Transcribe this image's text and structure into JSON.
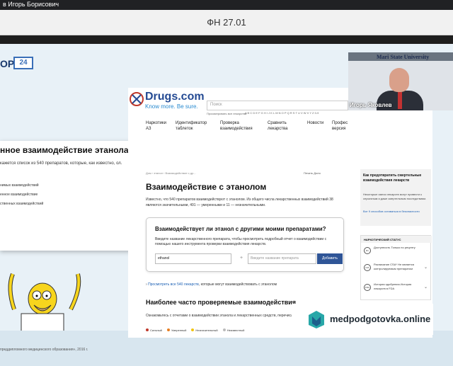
{
  "topbar": {
    "participant": "в Игорь Борисович"
  },
  "window": {
    "title": "ФН 27.01"
  },
  "slide": {
    "brand_text": "OP",
    "brand_badge": "24",
    "card_title": "нное взаимодействие этанола",
    "card_text": "кажется список из 540 препаратов, которые, как известно, ол.",
    "card_items": [
      "нимых взаимодействий",
      "енное взаимодействие",
      "ственных взаимодействий"
    ],
    "footer_note": "преддипломного медицинского образования», 2016 г."
  },
  "drugs": {
    "logo_name": "Drugs.com",
    "logo_slogan": "Know more. Be sure.",
    "search_placeholder": "Поиск",
    "search_sub": "Просматривать все лекарства",
    "alphabet": "A B C D E F G H I J K L M N O P Q R S T U V W X Y Z 0-9",
    "nav": [
      "Наркотики АЗ",
      "Идентификатор таблеток",
      "Проверка взаимодействия",
      "Сравнить лекарства",
      "Новости",
      "Профес версия"
    ],
    "breadcrumb": "Дом › этанол › Взаимодействие с др...",
    "actions": "Печать   Доля",
    "h1": "Взаимодействие с этанолом",
    "intro": "Известно, что 540 препаратов взаимодействуют с этанолом. Из общего числа лекарственных взаимодействий 38 являются значительными, 491 — умеренными и 11 — незначительными.",
    "box_title": "Взаимодействует ли этанол с другими моими препаратами?",
    "box_desc": "Введите название лекарственного препарата, чтобы просмотреть подробный отчет о взаимодействии с помощью нашего инструмента проверки взаимодействия лекарств.",
    "input1_value": "ethanol",
    "input2_placeholder": "Введите название препарата",
    "add_button": "Добавить",
    "link540": "Просмотреть все 540 лекарств",
    "link540_tail": ", которые могут взаимодействовать с этанолом",
    "h2": "Наиболее часто проверяемые взаимодействия",
    "desc2": "Ознакомьтесь с отчетами о взаимодействии этанола и лекарственных средств, перечисленных ниже.",
    "legend": [
      "Сильный",
      "Умеренный",
      "Незначительный",
      "Неизвестный"
    ],
    "legend_colors": [
      "#c0392b",
      "#e67e22",
      "#f1c40f",
      "#bbbbbb"
    ],
    "side1_title": "Как предотвратить смертельные взаимодействия лекарств",
    "side1_desc": "Некоторые смеси лекарств могут привести к серьезным и даже смертельным последствиям.",
    "side1_link": "Вот 9 способов оставаться в безопасности",
    "side2_title": "НАРКОТИЧЕСКИЙ СТАТУС",
    "side2_rows": [
      {
        "icon": "Rx",
        "label": "Доступность Только по рецепту"
      },
      {
        "icon": "N/A",
        "label": "Расписание CSA* Не является контролируемым препаратом"
      },
      {
        "icon": "FDA",
        "label": "История одобрения История лекарств в FDA"
      }
    ]
  },
  "webcam": {
    "university": "Mari State University",
    "speaker": "Игорь Яковлев"
  },
  "sponsor": {
    "text": "medpodgotovka.online"
  }
}
